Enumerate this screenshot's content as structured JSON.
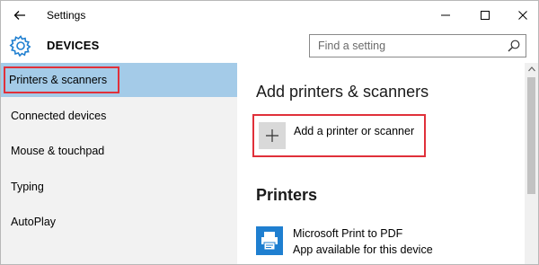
{
  "window": {
    "title": "Settings",
    "controls": [
      "minimize",
      "maximize",
      "close"
    ]
  },
  "header": {
    "section": "DEVICES",
    "search": {
      "placeholder": "Find a setting",
      "value": ""
    }
  },
  "sidebar": {
    "items": [
      {
        "label": "Printers & scanners",
        "active": true
      },
      {
        "label": "Connected devices",
        "active": false
      },
      {
        "label": "Mouse & touchpad",
        "active": false
      },
      {
        "label": "Typing",
        "active": false
      },
      {
        "label": "AutoPlay",
        "active": false
      }
    ]
  },
  "main": {
    "add_heading": "Add printers & scanners",
    "add_button_label": "Add a printer or scanner",
    "printers_heading": "Printers",
    "printers": [
      {
        "name": "Microsoft Print to PDF",
        "status": "App available for this device"
      }
    ]
  },
  "colors": {
    "accent": "#1f7fd0",
    "selection": "#a4cbe8",
    "highlight_border": "#e0303a",
    "sidebar_bg": "#f2f2f2"
  }
}
